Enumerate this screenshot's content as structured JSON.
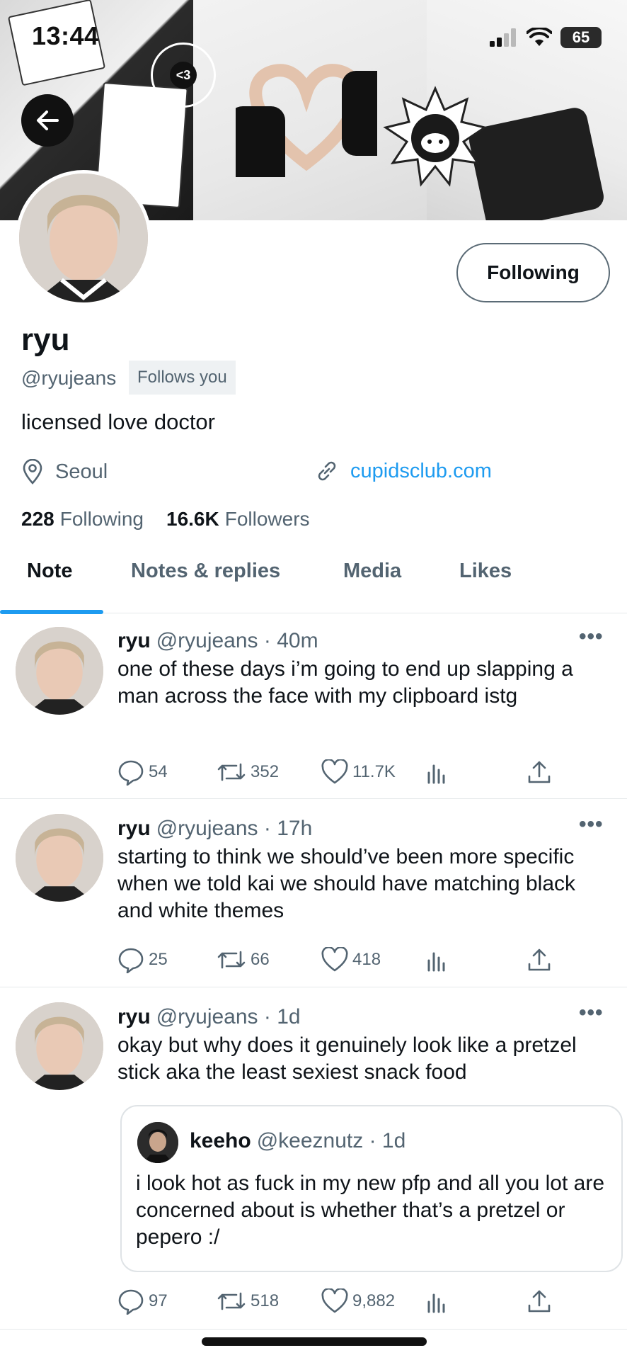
{
  "status_bar": {
    "time": "13:44",
    "battery": "65"
  },
  "banner": {
    "badge": "<3"
  },
  "profile": {
    "display_name": "ryu",
    "handle": "@ryujeans",
    "follows_you": "Follows you",
    "bio": "licensed love doctor",
    "location": "Seoul",
    "link": "cupidsclub.com",
    "following_count": "228",
    "following_label": "Following",
    "followers_count": "16.6K",
    "followers_label": "Followers",
    "follow_button": "Following"
  },
  "tabs": [
    "Note",
    "Notes & replies",
    "Media",
    "Likes"
  ],
  "tweets": [
    {
      "name": "ryu",
      "handle": "@ryujeans",
      "time": "· 40m",
      "text": "one of these days i’m going to end up slapping a man across the face with my clipboard istg",
      "replies": "54",
      "retweets": "352",
      "likes": "11.7K"
    },
    {
      "name": "ryu",
      "handle": "@ryujeans",
      "time": "· 17h",
      "text": "starting to think we should’ve been more specific when we told kai we should have matching black and white themes",
      "replies": "25",
      "retweets": "66",
      "likes": "418"
    },
    {
      "name": "ryu",
      "handle": "@ryujeans",
      "time": "· 1d",
      "text": "okay but why does it genuinely look like a pretzel stick aka the least sexiest snack food",
      "replies": "97",
      "retweets": "518",
      "likes": "9,882",
      "quote": {
        "name": "keeho",
        "handle": "@keeznutz",
        "time": "· 1d",
        "text": "i look hot as fuck in my new pfp and all you lot are concerned about is whether that’s a pretzel or pepero :/"
      }
    }
  ],
  "more_glyph": "•••"
}
